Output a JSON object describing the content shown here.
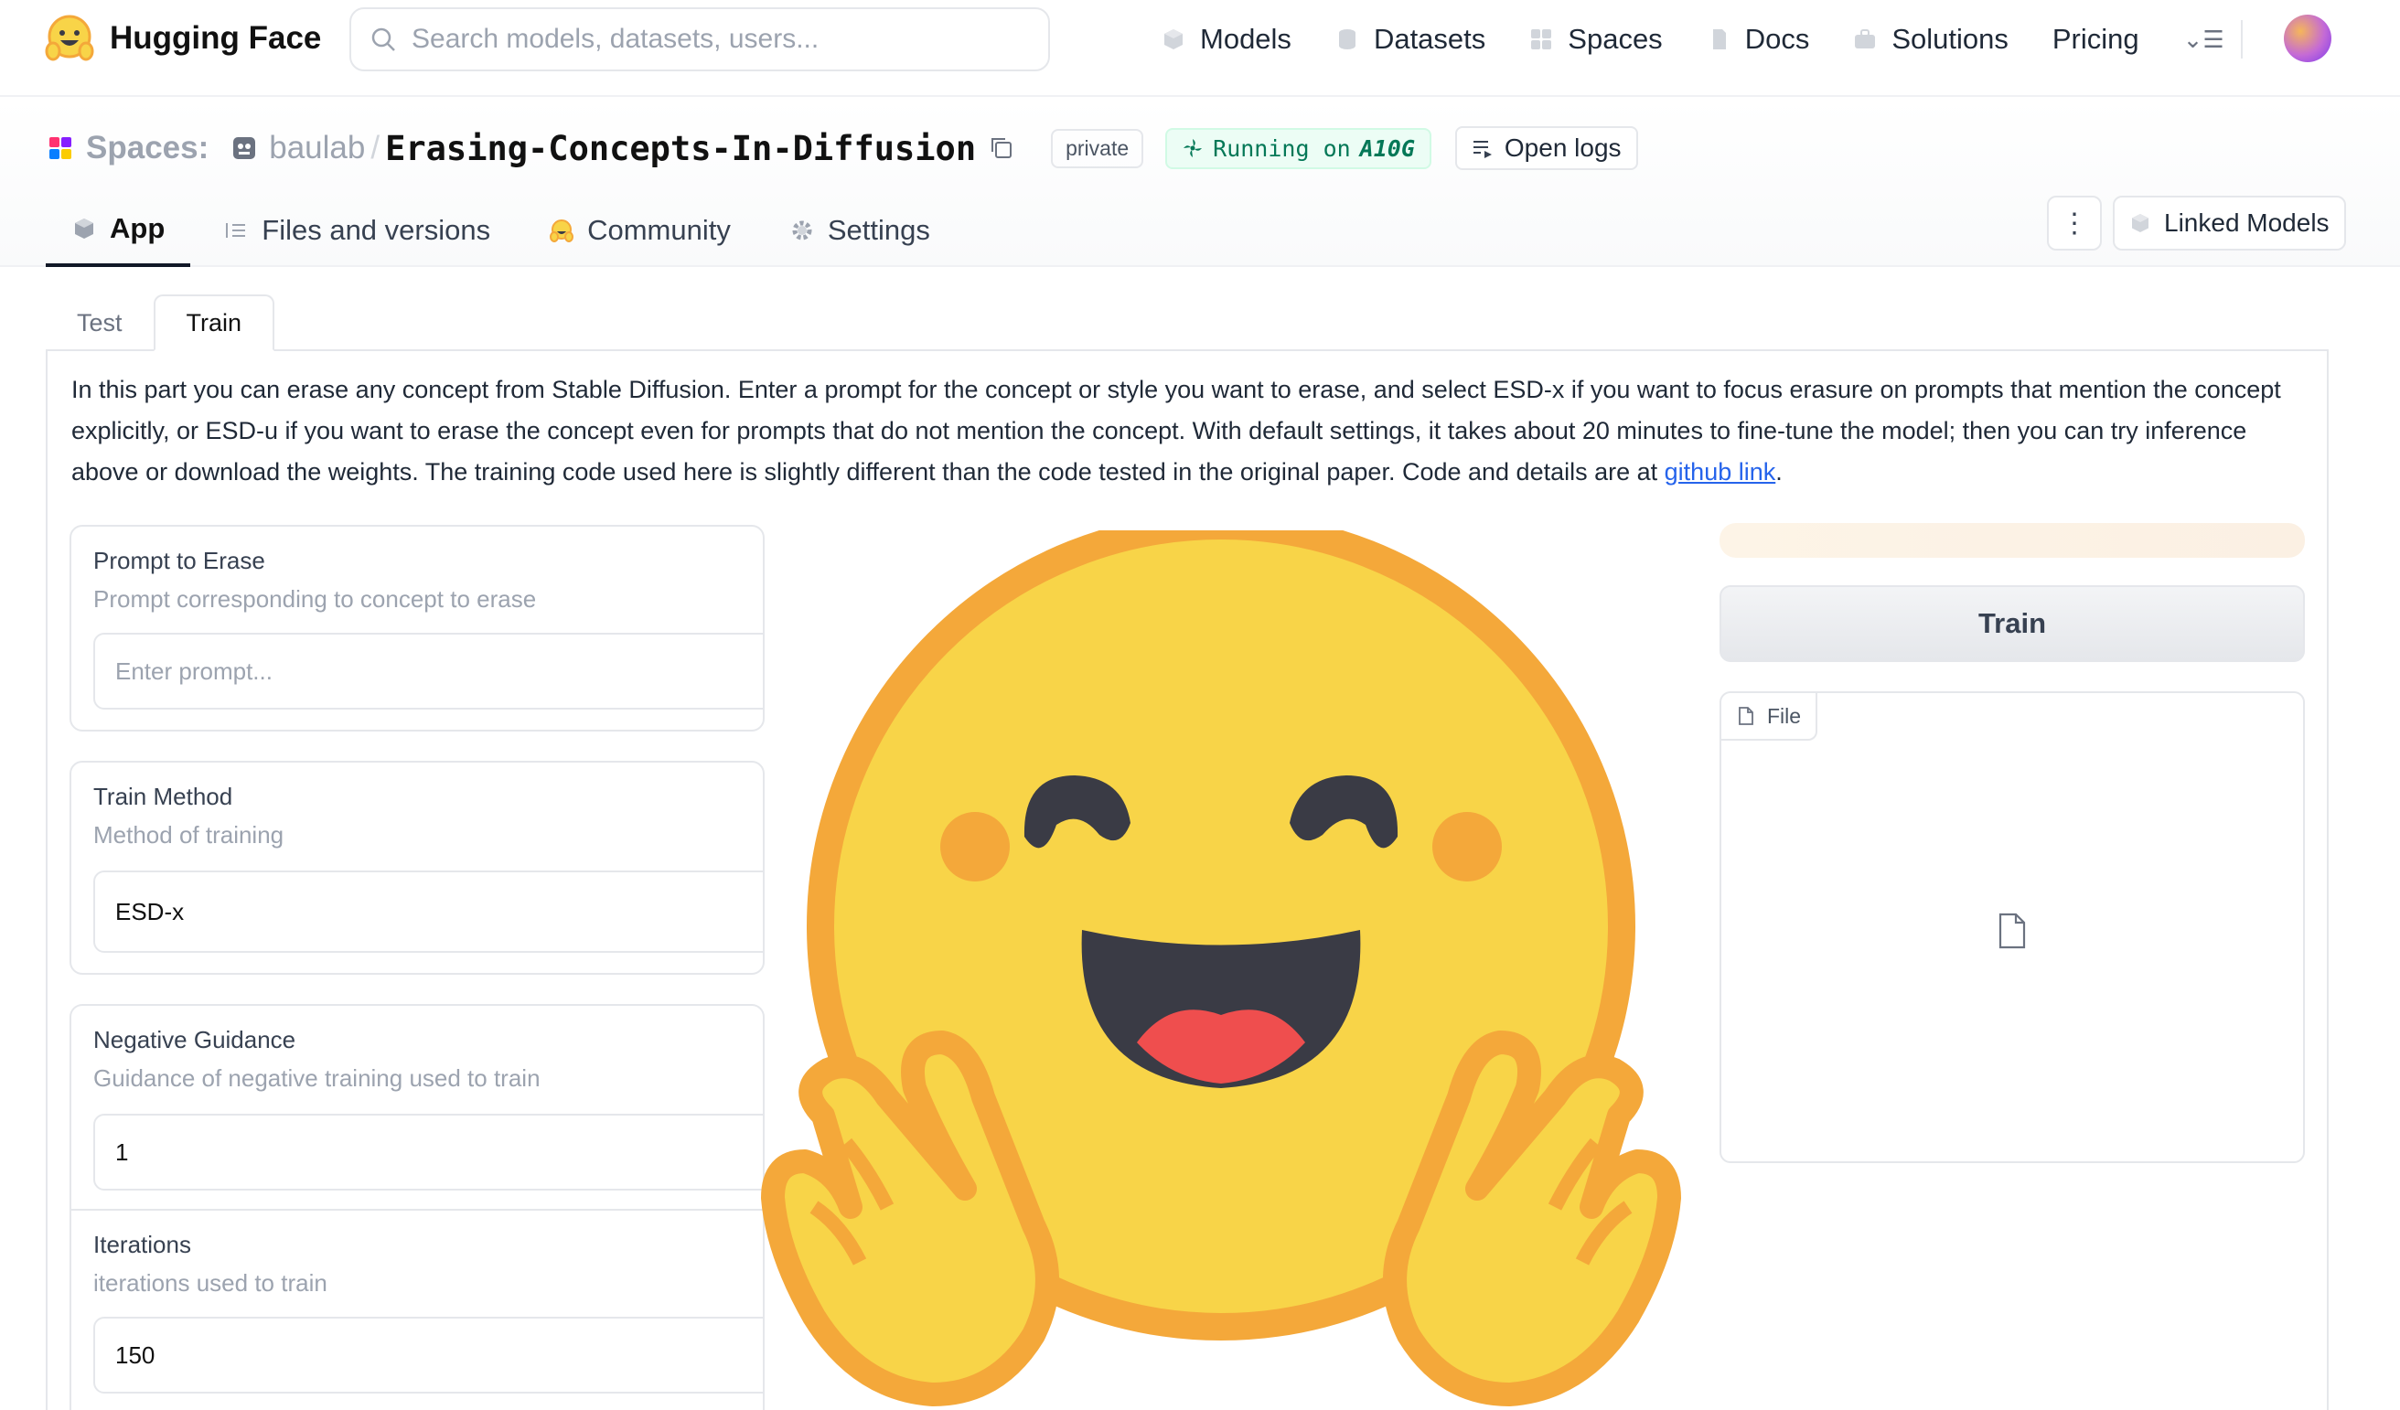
{
  "nav": {
    "brand": "Hugging Face",
    "search_placeholder": "Search models, datasets, users...",
    "links": [
      {
        "label": "Models",
        "icon": "cube-icon"
      },
      {
        "label": "Datasets",
        "icon": "database-icon"
      },
      {
        "label": "Spaces",
        "icon": "grid-icon"
      },
      {
        "label": "Docs",
        "icon": "doc-icon"
      },
      {
        "label": "Solutions",
        "icon": "briefcase-icon"
      },
      {
        "label": "Pricing",
        "icon": ""
      }
    ],
    "more_menu": "⌄☰"
  },
  "space": {
    "section_label": "Spaces:",
    "owner": "baulab",
    "separator": "/",
    "name": "Erasing-Concepts-In-Diffusion",
    "visibility_badge": "private",
    "status_prefix": "Running on",
    "status_hardware": "A10G",
    "logs_button": "Open logs"
  },
  "tabs": [
    {
      "label": "App",
      "icon": "cube-icon",
      "active": true
    },
    {
      "label": "Files and versions",
      "icon": "files-icon",
      "active": false
    },
    {
      "label": "Community",
      "icon": "hf-face-icon",
      "active": false
    },
    {
      "label": "Settings",
      "icon": "gear-icon",
      "active": false
    }
  ],
  "actions": {
    "kebab": "⋮",
    "linked_models": "Linked Models"
  },
  "app": {
    "tabs": [
      {
        "label": "Test",
        "active": false
      },
      {
        "label": "Train",
        "active": true
      }
    ],
    "description_before": "In this part you can erase any concept from Stable Diffusion. Enter a prompt for the concept or style you want to erase, and select ESD-x if you want to focus erasure on prompts that mention the concept explicitly, or ESD-u if you want to erase the concept even for prompts that do not mention the concept. With default settings, it takes about 20 minutes to fine-tune the model; then you can try inference above or download the weights. The training code used here is slightly different than the code tested in the original paper. Code and details are at ",
    "description_link": "github link",
    "description_after": ".",
    "fields": [
      {
        "label": "Prompt to Erase",
        "info": "Prompt corresponding to concept to erase",
        "value": "",
        "placeholder": "Enter prompt..."
      },
      {
        "label": "Train Method",
        "info": "Method of training",
        "value": "ESD-x",
        "placeholder": ""
      },
      {
        "label": "Negative Guidance",
        "info": "Guidance of negative training used to train",
        "value": "1",
        "placeholder": ""
      },
      {
        "label": "Iterations",
        "info": "iterations used to train",
        "value": "150",
        "placeholder": ""
      }
    ],
    "train_button": "Train",
    "file_label": "File"
  },
  "colors": {
    "accent_green": "#047857",
    "link_blue": "#2563eb",
    "mascot_yellow": "#F8D448",
    "mascot_orange": "#F4A83A"
  }
}
